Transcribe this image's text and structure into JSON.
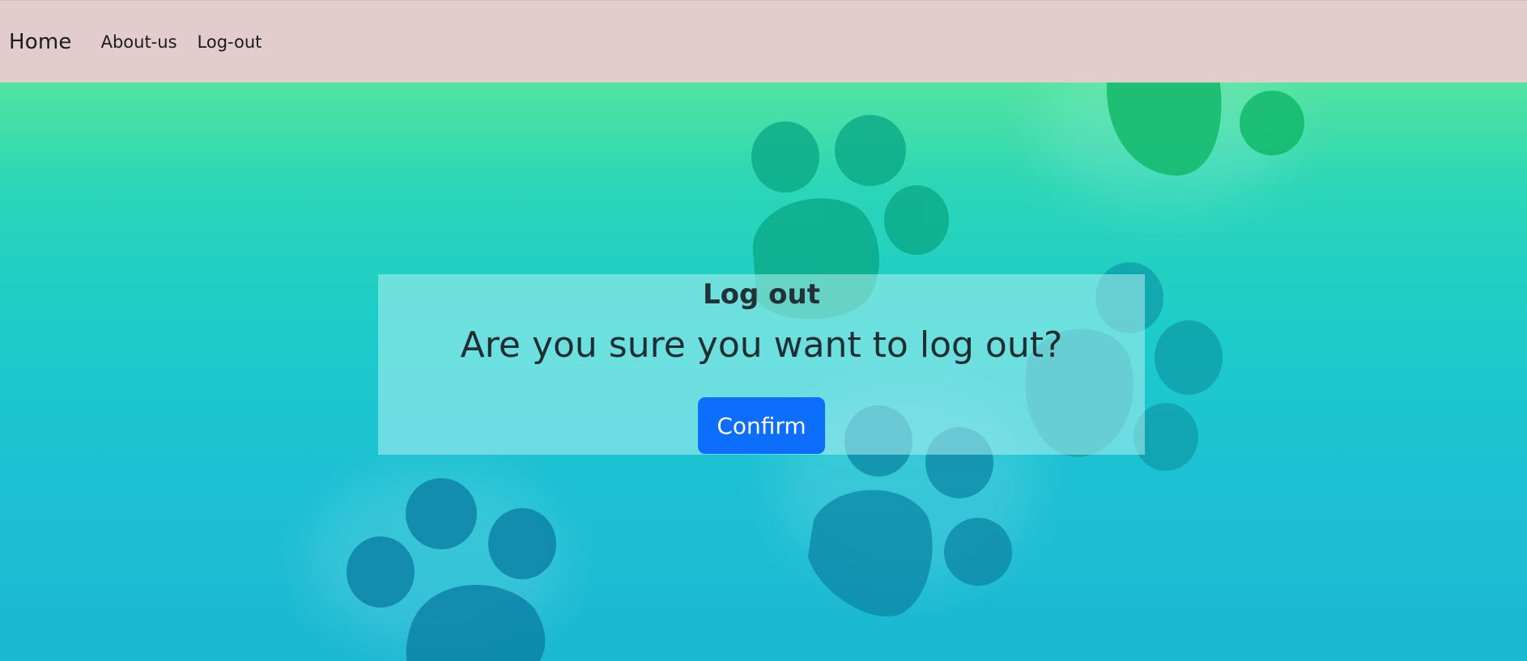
{
  "nav": {
    "brand": "Home",
    "links": [
      {
        "label": "About-us"
      },
      {
        "label": "Log-out"
      }
    ]
  },
  "background": {
    "decoration": "paw-print pattern",
    "colors": {
      "top": "#52e3a0",
      "bottom": "#1bb8d2"
    }
  },
  "modal": {
    "title": "Log out",
    "question": "Are you sure you want to log out?",
    "confirm_label": "Confirm"
  },
  "colors": {
    "navbar": "#e2cccd",
    "primary_button": "#0d6efd"
  }
}
